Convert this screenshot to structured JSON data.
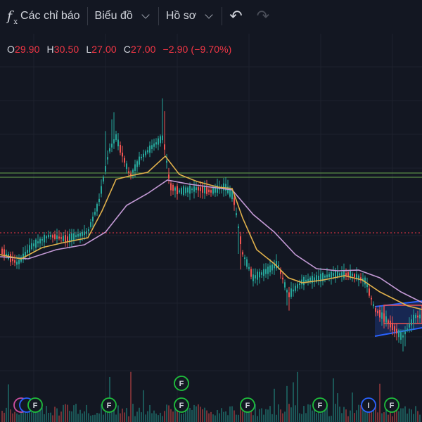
{
  "toolbar": {
    "indicators_label": "Các chỉ báo",
    "chart_label": "Biểu đồ",
    "profile_label": "Hồ sơ",
    "fx_icon_text": "f",
    "fx_icon_sub": "x"
  },
  "legend": {
    "open_key": "O",
    "open_value": "29.90",
    "high_key": "H",
    "high_value": "30.50",
    "low_key": "L",
    "low_value": "27.00",
    "close_key": "C",
    "close_value": "27.00",
    "change_text": "−2.90 (−9.70%)"
  },
  "colors": {
    "background": "#131722",
    "up": "#26a69a",
    "down": "#ef5350",
    "ma_fast": "#e0b04b",
    "ma_slow": "#c49ad6",
    "level_line": "#6aa84f",
    "price_dotted": "#f23645",
    "channel": "#2962ff",
    "marker_f": "#1fbf3c",
    "marker_other": "#2962ff",
    "marker_pink": "#cc4fa0"
  },
  "markers": {
    "f_label": "F",
    "other_label": "I"
  }
}
